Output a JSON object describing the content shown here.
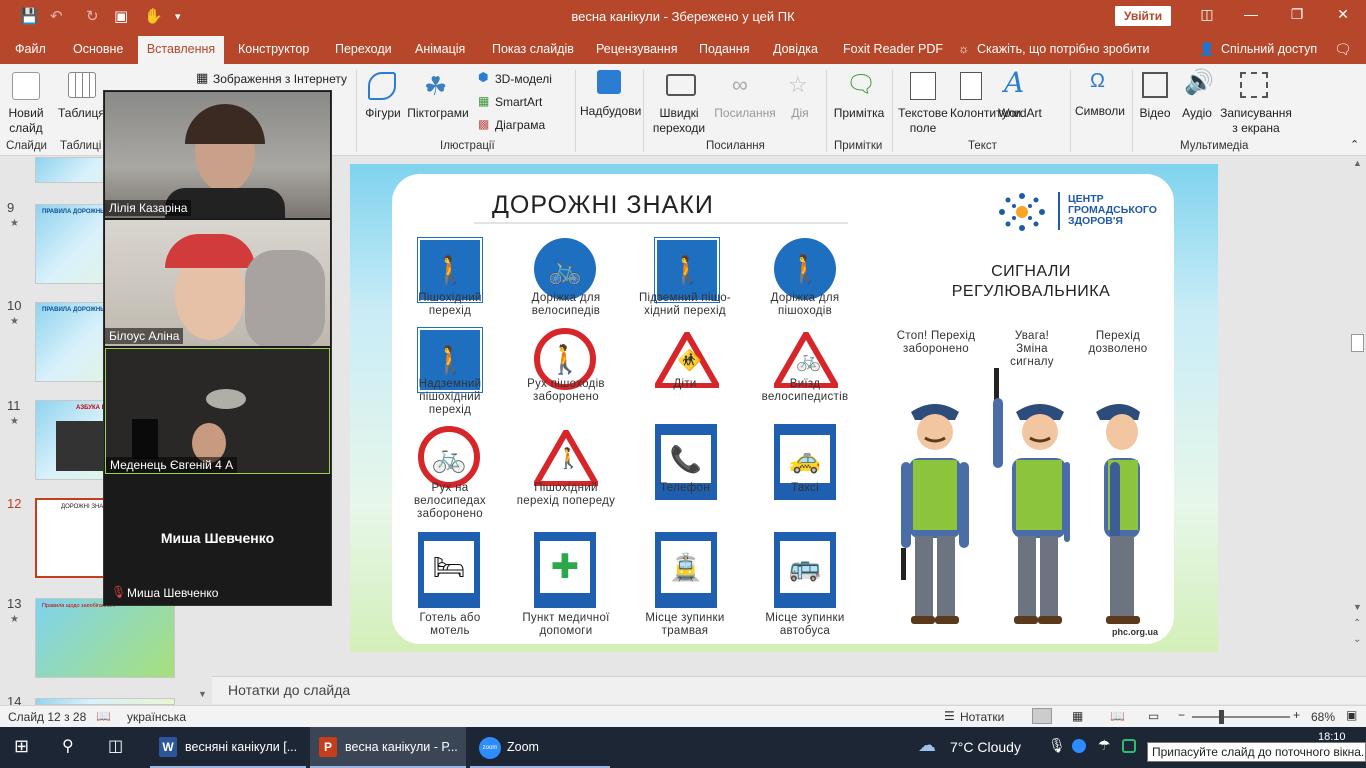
{
  "window": {
    "title": "весна канікули  -  Збережено у цей ПК",
    "signin": "Увійти"
  },
  "tabs": [
    "Файл",
    "Основне",
    "Вставлення",
    "Конструктор",
    "Переходи",
    "Анімація",
    "Показ слайдів",
    "Рецензування",
    "Подання",
    "Довідка",
    "Foxit Reader PDF"
  ],
  "tell_me": "Скажіть, що потрібно зробити",
  "share": "Спільний доступ",
  "ribbon": {
    "new_slide": "Новий слайд",
    "table": "Таблиця",
    "online_pictures": "Зображення з Інтернету",
    "shapes": "Фігури",
    "icons": "Піктограми",
    "models3d": "3D-моделі",
    "smartart": "SmartArt",
    "chart": "Діаграма",
    "addins": "Надбудови",
    "quick_links": "Швидкі переходи",
    "links": "Посилання",
    "action": "Дія",
    "comment": "Примітка",
    "textbox": "Текстове поле",
    "header_footer": "Колонтитули",
    "wordart": "WordArt",
    "symbols": "Символи",
    "video": "Відео",
    "audio": "Аудіо",
    "screen_recording": "Записування з екрана",
    "groups": {
      "slides": "Слайди",
      "tables": "Таблиці",
      "illustrations": "Ілюстрації",
      "links": "Посилання",
      "comments": "Примітки",
      "text": "Текст",
      "media": "Мультимедіа"
    }
  },
  "thumbs": [
    {
      "num": "9",
      "text": "ПРАВИЛА ДОРОЖНЬОГО..."
    },
    {
      "num": "10",
      "text": "ПРАВИЛА ДОРОЖНЬОГО"
    },
    {
      "num": "11",
      "text": "АЗБУКА БЕЗПЕКИ"
    },
    {
      "num": "12",
      "text": "ДОРОЖНІ ЗНАКИ"
    },
    {
      "num": "13",
      "text": "Правила щодо запобігання..."
    },
    {
      "num": "14",
      "text": "Правила щодо запобігання"
    }
  ],
  "slide": {
    "title": "ДОРОЖНІ ЗНАКИ",
    "org": "ЦЕНТР ГРОМАДСЬКОГО ЗДОРОВ'Я",
    "subtitle": "СИГНАЛИ РЕГУЛЮВАЛЬНИКА",
    "signals": [
      "Стоп! Перехід заборонено",
      "Увага! Зміна сигналу",
      "Перехід дозволено"
    ],
    "signs": [
      "Пішохідний перехід",
      "Доріжка для велосипедів",
      "Підземний пішо-хідний перехід",
      "Доріжка для пішоходів",
      "Надземний пішохідний перехід",
      "Рух пішоходів заборонено",
      "Діти",
      "Виїзд велосипедистів",
      "Рух на велосипедах заборонено",
      "Пішохідний перехід попереду",
      "Телефон",
      "Таксі",
      "Готель або мотель",
      "Пункт медичної допомоги",
      "Місце зупинки трамвая",
      "Місце зупинки автобуса"
    ],
    "site": "phc.org.ua"
  },
  "notes": "Нотатки до слайда",
  "status": {
    "slide": "Слайд 12 з 28",
    "lang": "українська",
    "notes_btn": "Нотатки",
    "zoom": "68%"
  },
  "zoom_call": {
    "participants": [
      "Лілія Казаріна",
      "Білоус Аліна",
      "Меденець Євгеній 4 А"
    ],
    "audio_only": "Миша Шевченко",
    "audio_only_label": "Миша Шевченко"
  },
  "taskbar": {
    "word": "весняні канікули [...",
    "ppt": "весна канікули - Р...",
    "zoom": "Zoom",
    "weather": "7°C  Cloudy",
    "time": "18:10"
  },
  "tooltip": "Припасуйте слайд до поточного вікна."
}
